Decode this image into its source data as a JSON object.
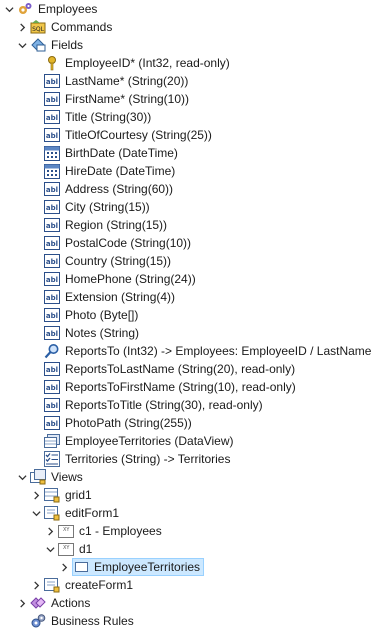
{
  "tree": {
    "root": "Employees",
    "commands": "Commands",
    "fields_label": "Fields",
    "fields": [
      "EmployeeID* (Int32, read-only)",
      "LastName* (String(20))",
      "FirstName* (String(10))",
      "Title (String(30))",
      "TitleOfCourtesy (String(25))",
      "BirthDate (DateTime)",
      "HireDate (DateTime)",
      "Address (String(60))",
      "City (String(15))",
      "Region (String(15))",
      "PostalCode (String(10))",
      "Country (String(15))",
      "HomePhone (String(24))",
      "Extension (String(4))",
      "Photo (Byte[])",
      "Notes (String)",
      "ReportsTo (Int32) -> Employees: EmployeeID / LastName",
      "ReportsToLastName (String(20), read-only)",
      "ReportsToFirstName (String(10), read-only)",
      "ReportsToTitle (String(30), read-only)",
      "PhotoPath (String(255))",
      "EmployeeTerritories (DataView)",
      "Territories (String) -> Territories"
    ],
    "views_label": "Views",
    "grid1": "grid1",
    "editform1": "editForm1",
    "c1": "c1 - Employees",
    "d1": "d1",
    "employee_territories": "EmployeeTerritories",
    "createform1": "createForm1",
    "actions": "Actions",
    "business_rules": "Business Rules"
  },
  "colors": {
    "selection_bg": "#cce8ff",
    "selection_border": "#99d1ff",
    "abl_icon": "#2b4f8a",
    "key_icon": "#d4a017"
  }
}
